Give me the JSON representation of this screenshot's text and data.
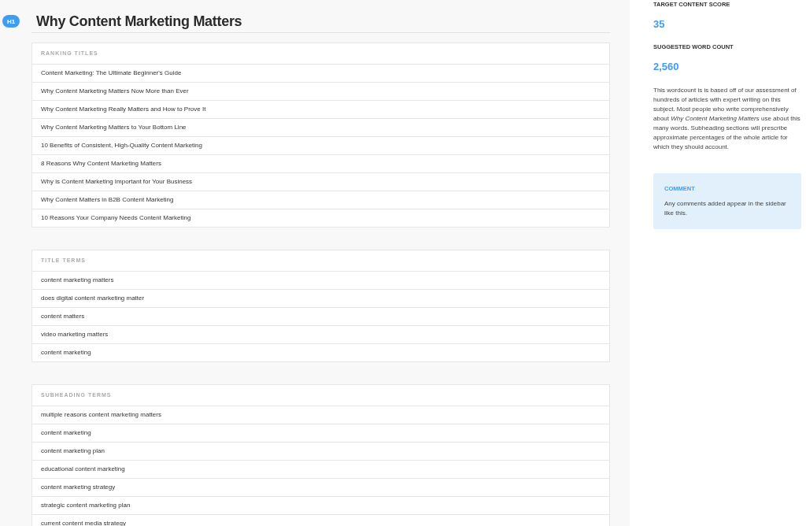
{
  "heading": {
    "badge": "H1",
    "title": "Why Content Marketing Matters"
  },
  "sections": [
    {
      "title": "RANKING TITLES",
      "items": [
        "Content Marketing: The Ultimate Beginner's Guide",
        "Why Content Marketing Matters Now More than Ever",
        "Why Content Marketing Really Matters and How to Prove It",
        "Why Content Marketing Matters to Your Bottom Line",
        "10 Benefits of Consistent, High-Quality Content Marketing",
        "8 Reasons Why Content Marketing Matters",
        "Why is Content Marketing Important for Your Business",
        "Why Content Matters in B2B Content Marketing",
        "10 Reasons Your Company Needs Content Marketing"
      ]
    },
    {
      "title": "TITLE TERMS",
      "items": [
        "content marketing matters",
        "does digital content marketing matter",
        "content matters",
        "video marketing matters",
        "content marketing"
      ]
    },
    {
      "title": "SUBHEADING TERMS",
      "items": [
        "multiple reasons content marketing matters",
        "content marketing",
        "content marketing plan",
        "educational content marketing",
        "content marketing strategy",
        "strategic content marketing plan",
        "current content media strategy"
      ]
    }
  ],
  "sidebar": {
    "target_label": "TARGET CONTENT SCORE",
    "target_value": "35",
    "wordcount_label": "SUGGESTED WORD COUNT",
    "wordcount_value": "2,560",
    "description": "This wordcount is is based off of our assessment of hundreds of articles with expert writing on this subject. Most people who write comprehensively about *Why Content Marketing Matters* use about this many words. Subheading sections will prescribe approximate percentages of the whole article for which they should account.",
    "comment": {
      "title": "COMMENT",
      "text": "Any comments added appear in the sidebar like this."
    }
  }
}
